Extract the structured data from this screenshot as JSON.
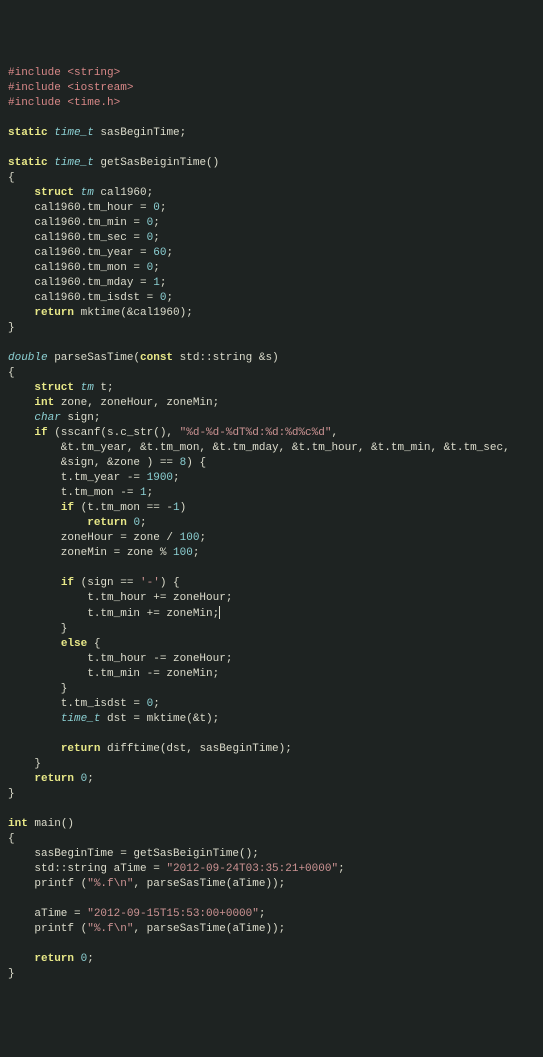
{
  "lines": [
    [
      [
        "preproc",
        "#include"
      ],
      [
        "id",
        " "
      ],
      [
        "angleinc",
        "<string>"
      ]
    ],
    [
      [
        "preproc",
        "#include"
      ],
      [
        "id",
        " "
      ],
      [
        "angleinc",
        "<iostream>"
      ]
    ],
    [
      [
        "preproc",
        "#include"
      ],
      [
        "id",
        " "
      ],
      [
        "angleinc",
        "<time.h>"
      ]
    ],
    [],
    [
      [
        "kw",
        "static"
      ],
      [
        "id",
        " "
      ],
      [
        "type",
        "time_t"
      ],
      [
        "id",
        " sasBeginTime;"
      ]
    ],
    [],
    [
      [
        "kw",
        "static"
      ],
      [
        "id",
        " "
      ],
      [
        "type",
        "time_t"
      ],
      [
        "id",
        " getSasBeiginTime()"
      ]
    ],
    [
      [
        "brace",
        "{"
      ]
    ],
    [
      [
        "id",
        "    "
      ],
      [
        "kw",
        "struct"
      ],
      [
        "id",
        " "
      ],
      [
        "type",
        "tm"
      ],
      [
        "id",
        " cal1960;"
      ]
    ],
    [
      [
        "id",
        "    cal1960.tm_hour = "
      ],
      [
        "num",
        "0"
      ],
      [
        "id",
        ";"
      ]
    ],
    [
      [
        "id",
        "    cal1960.tm_min = "
      ],
      [
        "num",
        "0"
      ],
      [
        "id",
        ";"
      ]
    ],
    [
      [
        "id",
        "    cal1960.tm_sec = "
      ],
      [
        "num",
        "0"
      ],
      [
        "id",
        ";"
      ]
    ],
    [
      [
        "id",
        "    cal1960.tm_year = "
      ],
      [
        "num",
        "60"
      ],
      [
        "id",
        ";"
      ]
    ],
    [
      [
        "id",
        "    cal1960.tm_mon = "
      ],
      [
        "num",
        "0"
      ],
      [
        "id",
        ";"
      ]
    ],
    [
      [
        "id",
        "    cal1960.tm_mday = "
      ],
      [
        "num",
        "1"
      ],
      [
        "id",
        ";"
      ]
    ],
    [
      [
        "id",
        "    cal1960.tm_isdst = "
      ],
      [
        "num",
        "0"
      ],
      [
        "id",
        ";"
      ]
    ],
    [
      [
        "id",
        "    "
      ],
      [
        "kw",
        "return"
      ],
      [
        "id",
        " mktime(&cal1960);"
      ]
    ],
    [
      [
        "brace",
        "}"
      ]
    ],
    [],
    [
      [
        "type",
        "double"
      ],
      [
        "id",
        " parseSasTime("
      ],
      [
        "kw",
        "const"
      ],
      [
        "id",
        " std::string &s)"
      ]
    ],
    [
      [
        "brace",
        "{"
      ]
    ],
    [
      [
        "id",
        "    "
      ],
      [
        "kw",
        "struct"
      ],
      [
        "id",
        " "
      ],
      [
        "type",
        "tm"
      ],
      [
        "id",
        " t;"
      ]
    ],
    [
      [
        "id",
        "    "
      ],
      [
        "kw",
        "int"
      ],
      [
        "id",
        " zone, zoneHour, zoneMin;"
      ]
    ],
    [
      [
        "id",
        "    "
      ],
      [
        "type",
        "char"
      ],
      [
        "id",
        " sign;"
      ]
    ],
    [
      [
        "id",
        "    "
      ],
      [
        "kw",
        "if"
      ],
      [
        "id",
        " (sscanf(s.c_str(), "
      ],
      [
        "str",
        "\"%d-%d-%dT%d:%d:%d%c%d\""
      ],
      [
        "id",
        ","
      ]
    ],
    [
      [
        "id",
        "        &t.tm_year, &t.tm_mon, &t.tm_mday, &t.tm_hour, &t.tm_min, &t.tm_sec,"
      ]
    ],
    [
      [
        "id",
        "        &sign, &zone ) == "
      ],
      [
        "num",
        "8"
      ],
      [
        "id",
        ") {"
      ]
    ],
    [
      [
        "id",
        "        t.tm_year -= "
      ],
      [
        "num",
        "1900"
      ],
      [
        "id",
        ";"
      ]
    ],
    [
      [
        "id",
        "        t.tm_mon -= "
      ],
      [
        "num",
        "1"
      ],
      [
        "id",
        ";"
      ]
    ],
    [
      [
        "id",
        "        "
      ],
      [
        "kw",
        "if"
      ],
      [
        "id",
        " (t.tm_mon == -"
      ],
      [
        "num",
        "1"
      ],
      [
        "id",
        ")"
      ]
    ],
    [
      [
        "id",
        "            "
      ],
      [
        "kw",
        "return"
      ],
      [
        "id",
        " "
      ],
      [
        "num",
        "0"
      ],
      [
        "id",
        ";"
      ]
    ],
    [
      [
        "id",
        "        zoneHour = zone / "
      ],
      [
        "num",
        "100"
      ],
      [
        "id",
        ";"
      ]
    ],
    [
      [
        "id",
        "        zoneMin = zone % "
      ],
      [
        "num",
        "100"
      ],
      [
        "id",
        ";"
      ]
    ],
    [],
    [
      [
        "id",
        "        "
      ],
      [
        "kw",
        "if"
      ],
      [
        "id",
        " (sign == "
      ],
      [
        "str",
        "'-'"
      ],
      [
        "id",
        ") {"
      ]
    ],
    [
      [
        "id",
        "            t.tm_hour += zoneHour;"
      ]
    ],
    [
      [
        "id",
        "            t.tm_min += zoneMin;"
      ],
      [
        "caret",
        ""
      ]
    ],
    [
      [
        "id",
        "        }"
      ]
    ],
    [
      [
        "id",
        "        "
      ],
      [
        "kw",
        "else"
      ],
      [
        "id",
        " {"
      ]
    ],
    [
      [
        "id",
        "            t.tm_hour -= zoneHour;"
      ]
    ],
    [
      [
        "id",
        "            t.tm_min -= zoneMin;"
      ]
    ],
    [
      [
        "id",
        "        }"
      ]
    ],
    [
      [
        "id",
        "        t.tm_isdst = "
      ],
      [
        "num",
        "0"
      ],
      [
        "id",
        ";"
      ]
    ],
    [
      [
        "id",
        "        "
      ],
      [
        "type",
        "time_t"
      ],
      [
        "id",
        " dst = mktime(&t);"
      ]
    ],
    [],
    [
      [
        "id",
        "        "
      ],
      [
        "kw",
        "return"
      ],
      [
        "id",
        " difftime(dst, sasBeginTime);"
      ]
    ],
    [
      [
        "id",
        "    }"
      ]
    ],
    [
      [
        "id",
        "    "
      ],
      [
        "kw",
        "return"
      ],
      [
        "id",
        " "
      ],
      [
        "num",
        "0"
      ],
      [
        "id",
        ";"
      ]
    ],
    [
      [
        "brace",
        "}"
      ]
    ],
    [],
    [
      [
        "kw",
        "int"
      ],
      [
        "id",
        " main()"
      ]
    ],
    [
      [
        "brace",
        "{"
      ]
    ],
    [
      [
        "id",
        "    sasBeginTime = getSasBeiginTime();"
      ]
    ],
    [
      [
        "id",
        "    std::string aTime = "
      ],
      [
        "str",
        "\"2012-09-24T03:35:21+0000\""
      ],
      [
        "id",
        ";"
      ]
    ],
    [
      [
        "id",
        "    printf ("
      ],
      [
        "str",
        "\"%.f\\n\""
      ],
      [
        "id",
        ", parseSasTime(aTime));"
      ]
    ],
    [],
    [
      [
        "id",
        "    aTime = "
      ],
      [
        "str",
        "\"2012-09-15T15:53:00+0000\""
      ],
      [
        "id",
        ";"
      ]
    ],
    [
      [
        "id",
        "    printf ("
      ],
      [
        "str",
        "\"%.f\\n\""
      ],
      [
        "id",
        ", parseSasTime(aTime));"
      ]
    ],
    [],
    [
      [
        "id",
        "    "
      ],
      [
        "kw",
        "return"
      ],
      [
        "id",
        " "
      ],
      [
        "num",
        "0"
      ],
      [
        "id",
        ";"
      ]
    ],
    [
      [
        "brace",
        "}"
      ]
    ]
  ]
}
